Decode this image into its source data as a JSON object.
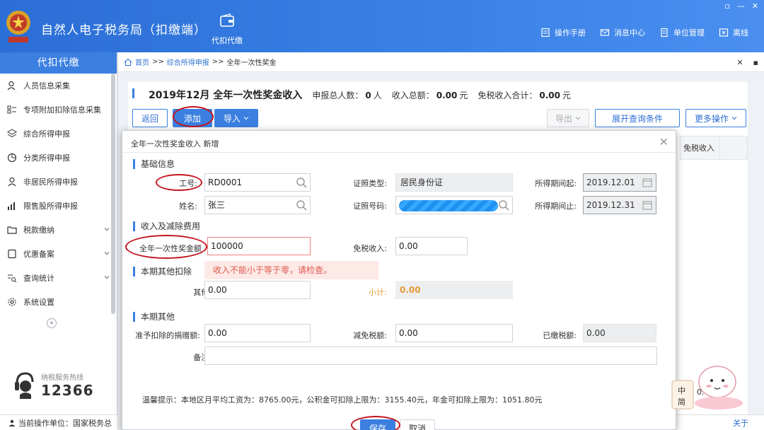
{
  "header": {
    "title": "自然人电子税务局（扣缴端）",
    "nav_label": "代扣代缴",
    "links": [
      "操作手册",
      "消息中心",
      "单位管理",
      "离线"
    ]
  },
  "sidebar": {
    "head": "代扣代缴",
    "items": [
      {
        "label": "人员信息采集",
        "icon": "person-icon"
      },
      {
        "label": "专项附加扣除信息采集",
        "icon": "list-icon"
      },
      {
        "label": "综合所得申报",
        "icon": "layers-icon"
      },
      {
        "label": "分类所得申报",
        "icon": "pie-icon"
      },
      {
        "label": "非居民所得申报",
        "icon": "user-icon"
      },
      {
        "label": "限售股所得申报",
        "icon": "bar-icon"
      },
      {
        "label": "税款缴纳",
        "icon": "folder-icon"
      },
      {
        "label": "优惠备案",
        "icon": "doc-icon"
      },
      {
        "label": "查询统计",
        "icon": "search-list-icon"
      },
      {
        "label": "系统设置",
        "icon": "gear-icon"
      }
    ],
    "collapse": "«",
    "hotline_text": "纳税服务热线",
    "hotline_number": "12366",
    "current_unit": "当前操作单位：国家税务总"
  },
  "breadcrumb": {
    "home": "首页",
    "sep1": ">>",
    "level1": "综合所得申报",
    "sep2": ">>",
    "current": "全年一次性奖金"
  },
  "page": {
    "title": "2019年12月 全年一次性奖金收入",
    "stat1_label": "申报总人数：",
    "stat1_value": "0",
    "stat1_unit": "人",
    "stat2_label": "收入总额：",
    "stat2_value": "0.00",
    "stat2_unit": "元",
    "stat3_label": "免税收入合计：",
    "stat3_value": "0.00",
    "stat3_unit": "元",
    "btn_back": "返回",
    "btn_add": "添加",
    "btn_import": "导入",
    "btn_export": "导出",
    "btn_expand": "展开查询条件",
    "btn_more": "更多操作",
    "col_tax_free": "免税收入",
    "bg_value": "0.00",
    "switch_link": "关于"
  },
  "modal": {
    "title": "全年一次性奖金收入 新增",
    "sec_basic": "基础信息",
    "lbl_id": "工号:",
    "val_id": "RD0001",
    "lbl_cert_type": "证照类型:",
    "val_cert_type": "居民身份证",
    "lbl_period_start": "所得期间起:",
    "val_period_start": "2019.12.01",
    "lbl_name": "姓名:",
    "val_name": "张三",
    "lbl_cert_no": "证照号码:",
    "lbl_period_end": "所得期间止:",
    "val_period_end": "2019.12.31",
    "sec_income": "收入及减除费用",
    "lbl_bonus": "全年一次性奖金额",
    "val_bonus": "100000",
    "lbl_tax_free": "免税收入:",
    "val_tax_free": "0.00",
    "sec_deduct": "本期其他扣除",
    "error_msg": "收入不能小于等于零，请检查。",
    "lbl_other": "其他:",
    "val_other": "0.00",
    "lbl_subtotal": "小计:",
    "val_subtotal": "0.00",
    "sec_other": "本期其他",
    "lbl_donation": "准予扣除的捐赠额:",
    "val_donation": "0.00",
    "lbl_relief": "减免税额:",
    "val_relief": "0.00",
    "lbl_paid": "已缴税额:",
    "val_paid": "0.00",
    "lbl_note": "备注:",
    "val_note": "",
    "tip": "温馨提示：本地区月平均工资为：8765.00元，公积金可扣除上限为：3155.40元，年金可扣除上限为：1051.80元",
    "btn_save": "保存",
    "btn_cancel": "取消"
  },
  "colors": {
    "brand": "#3b7fe0",
    "annotation": "#c4141c",
    "error": "#e05a4e"
  }
}
